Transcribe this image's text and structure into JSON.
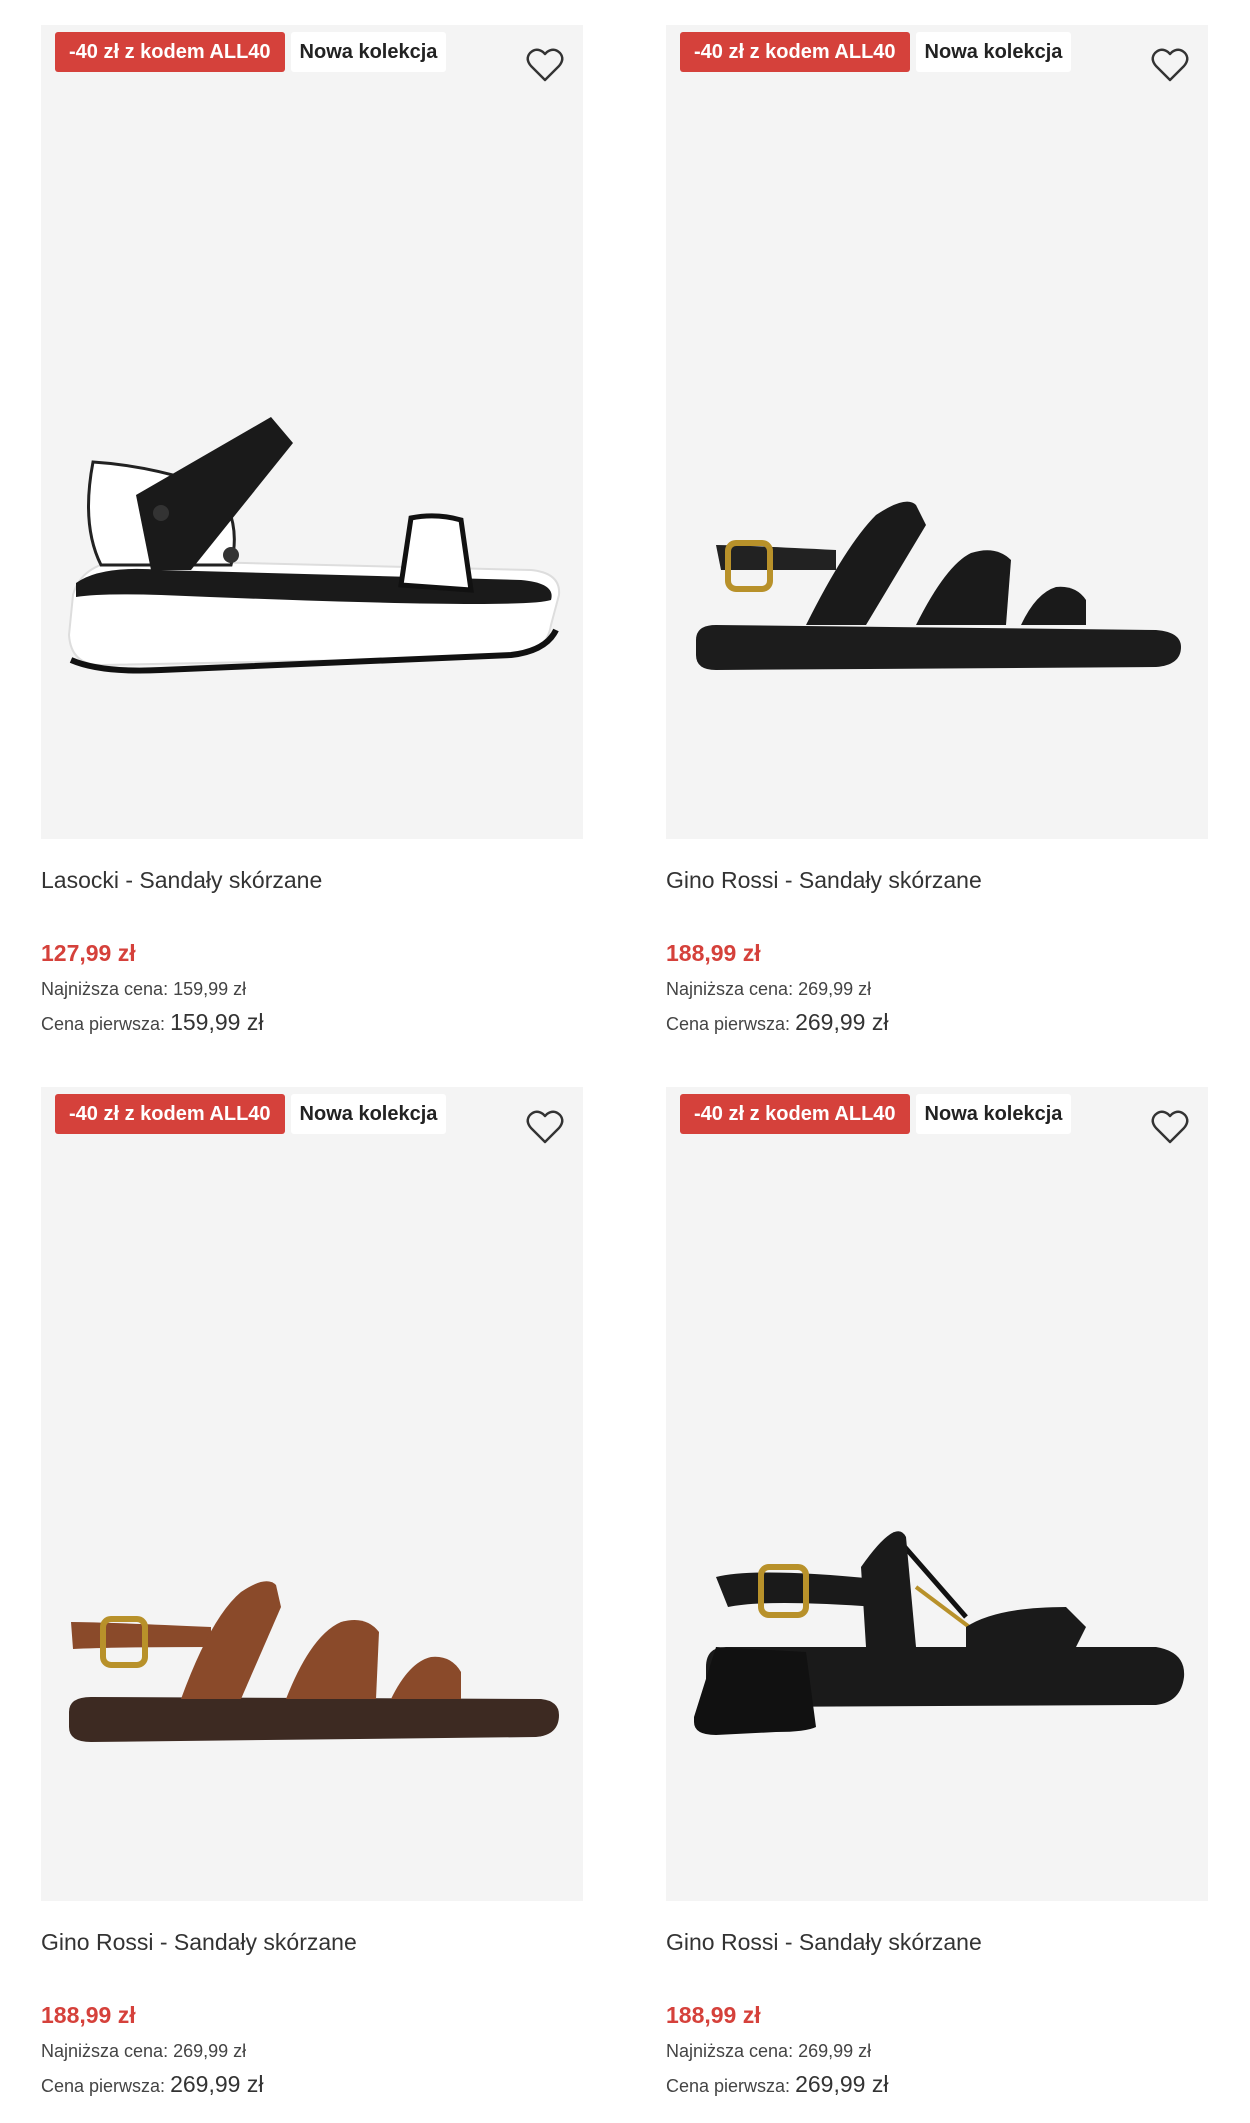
{
  "products": [
    {
      "promo_badge": "-40 zł z kodem ALL40",
      "new_badge": "Nowa kolekcja",
      "title": "Lasocki - Sandały skórzane",
      "price": "127,99 zł",
      "lowest_price_label": "Najniższa cena:",
      "lowest_price_value": "159,99 zł",
      "first_price_label": "Cena pierwsza:",
      "first_price_value": "159,99 zł"
    },
    {
      "promo_badge": "-40 zł z kodem ALL40",
      "new_badge": "Nowa kolekcja",
      "title": "Gino Rossi - Sandały skórzane",
      "price": "188,99 zł",
      "lowest_price_label": "Najniższa cena:",
      "lowest_price_value": "269,99 zł",
      "first_price_label": "Cena pierwsza:",
      "first_price_value": "269,99 zł"
    },
    {
      "promo_badge": "-40 zł z kodem ALL40",
      "new_badge": "Nowa kolekcja",
      "title": "Gino Rossi - Sandały skórzane",
      "price": "188,99 zł",
      "lowest_price_label": "Najniższa cena:",
      "lowest_price_value": "269,99 zł",
      "first_price_label": "Cena pierwsza:",
      "first_price_value": "269,99 zł"
    },
    {
      "promo_badge": "-40 zł z kodem ALL40",
      "new_badge": "Nowa kolekcja",
      "title": "Gino Rossi - Sandały skórzane",
      "price": "188,99 zł",
      "lowest_price_label": "Najniższa cena:",
      "lowest_price_value": "269,99 zł",
      "first_price_label": "Cena pierwsza:",
      "first_price_value": "269,99 zł"
    }
  ],
  "icons": {
    "favorite": "heart-outline-icon"
  },
  "colors": {
    "promo": "#d5413b",
    "price": "#d5413b",
    "image_bg": "#f4f4f4"
  }
}
